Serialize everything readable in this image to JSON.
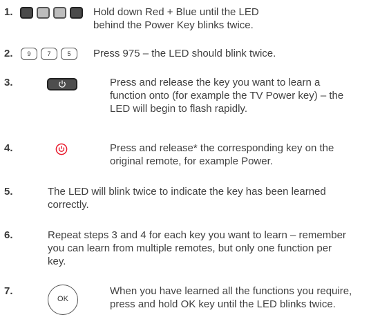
{
  "steps": [
    {
      "number": "1.",
      "text": "Hold down Red + Blue until the LED behind the Power Key blinks twice."
    },
    {
      "number": "2.",
      "text": "Press 975 – the LED should blink twice.",
      "keys": [
        "9",
        "7",
        "5"
      ]
    },
    {
      "number": "3.",
      "text": "Press and release the key you want to learn a function onto (for example the TV Power key) – the LED will begin to flash rapidly."
    },
    {
      "number": "4.",
      "text": "Press and release* the corresponding key on the original remote, for example Power."
    },
    {
      "number": "5.",
      "text": "The LED will blink twice to indicate the key has been learned correctly."
    },
    {
      "number": "6.",
      "text": "Repeat steps 3 and 4 for each key you want to learn – remember you can learn from multiple remotes, but only one function per key."
    },
    {
      "number": "7.",
      "text": "When you have learned all the functions you require, press and hold OK key until the LED blinks twice.",
      "button": "OK"
    }
  ],
  "icons": {
    "color_keys": [
      "dark-key-icon",
      "light-key-icon",
      "light-key-icon",
      "dark-key-icon"
    ],
    "tv_power_key": "power-key-icon",
    "original_power": "red-power-icon",
    "ok_button": "ok-button-icon"
  },
  "colors": {
    "accent": "#e8192c",
    "text": "#404040"
  }
}
